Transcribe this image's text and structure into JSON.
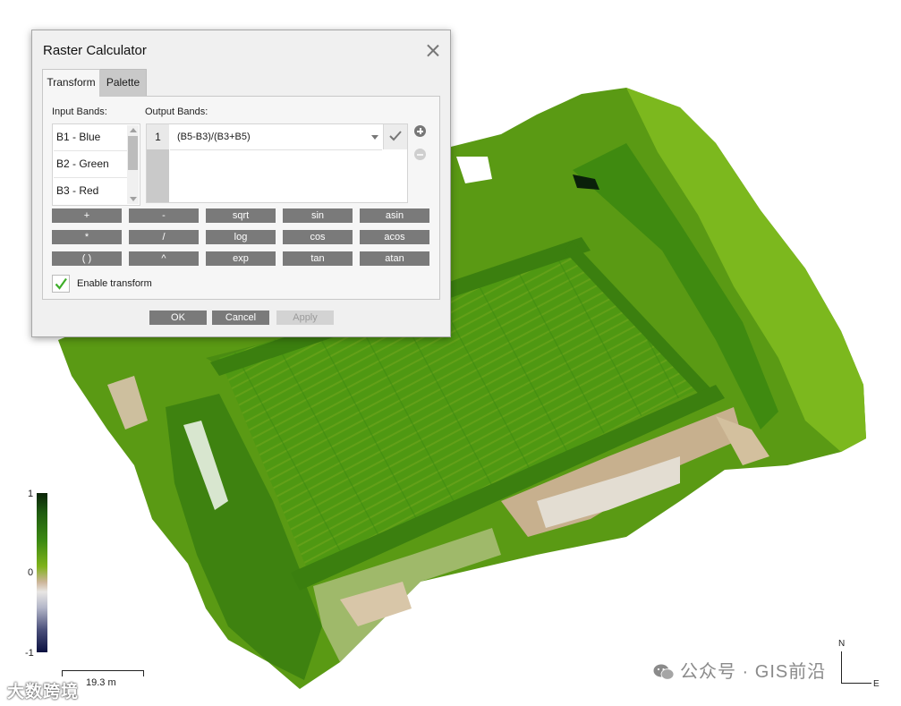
{
  "dialog": {
    "title": "Raster Calculator",
    "tabs": [
      {
        "label": "Transform",
        "active": true
      },
      {
        "label": "Palette",
        "active": false
      }
    ],
    "input_bands_label": "Input Bands:",
    "output_bands_label": "Output Bands:",
    "input_bands": [
      "B1 - Blue",
      "B2 - Green",
      "B3 - Red"
    ],
    "output_bands": [
      {
        "index": "1",
        "expression": "(B5-B3)/(B3+B5)"
      }
    ],
    "operators": [
      [
        "+",
        "-",
        "sqrt",
        "sin",
        "asin"
      ],
      [
        "*",
        "/",
        "log",
        "cos",
        "acos"
      ],
      [
        "( )",
        "^",
        "exp",
        "tan",
        "atan"
      ]
    ],
    "enable_transform": {
      "label": "Enable transform",
      "checked": true
    },
    "buttons": {
      "ok": "OK",
      "cancel": "Cancel",
      "apply": "Apply"
    }
  },
  "legend": {
    "max": "1",
    "mid": "0",
    "min": "-1"
  },
  "scalebar": {
    "label": "19.3 m"
  },
  "north_arrow": {
    "north": "N",
    "east": "E"
  },
  "watermarks": {
    "right": "公众号 · GIS前沿",
    "left": "大数跨境"
  },
  "colors": {
    "accent_check": "#3fae2a",
    "button_gray": "#7a7a7a",
    "ndvi_high": "#3c8a12",
    "ndvi_low": "#cdb59a"
  }
}
